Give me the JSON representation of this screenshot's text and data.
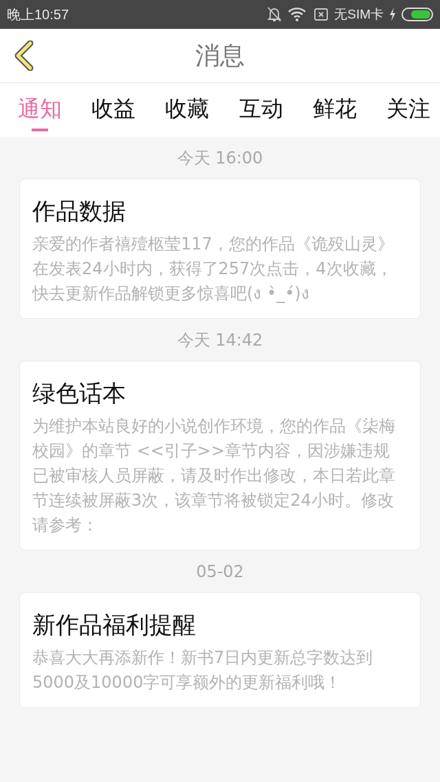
{
  "status_bar": {
    "time": "晚上10:57",
    "carrier": "无SIM卡"
  },
  "header": {
    "title": "消息"
  },
  "tabs": [
    {
      "label": "通知",
      "selected": true
    },
    {
      "label": "收益",
      "selected": false
    },
    {
      "label": "收藏",
      "selected": false
    },
    {
      "label": "互动",
      "selected": false
    },
    {
      "label": "鲜花",
      "selected": false
    },
    {
      "label": "关注",
      "selected": false
    }
  ],
  "messages": [
    {
      "time": "今天 16:00",
      "title": "作品数据",
      "body": "亲爱的作者禧殪柩莹117，您的作品《诡殁山灵》在发表24小时内，获得了257次点击，4次收藏，快去更新作品解锁更多惊喜吧(ง •̀_•́)ง"
    },
    {
      "time": "今天 14:42",
      "title": "绿色话本",
      "body": "为维护本站良好的小说创作环境，您的作品《柒梅校园》的章节 <<引子>>章节内容，因涉嫌违规已被审核人员屏蔽，请及时作出修改，本日若此章节连续被屏蔽3次，该章节将被锁定24小时。修改请参考："
    },
    {
      "time": "05-02",
      "title": "新作品福利提醒",
      "body": "恭喜大大再添新作！新书7日内更新总字数达到5000及10000字可享额外的更新福利哦！"
    }
  ]
}
